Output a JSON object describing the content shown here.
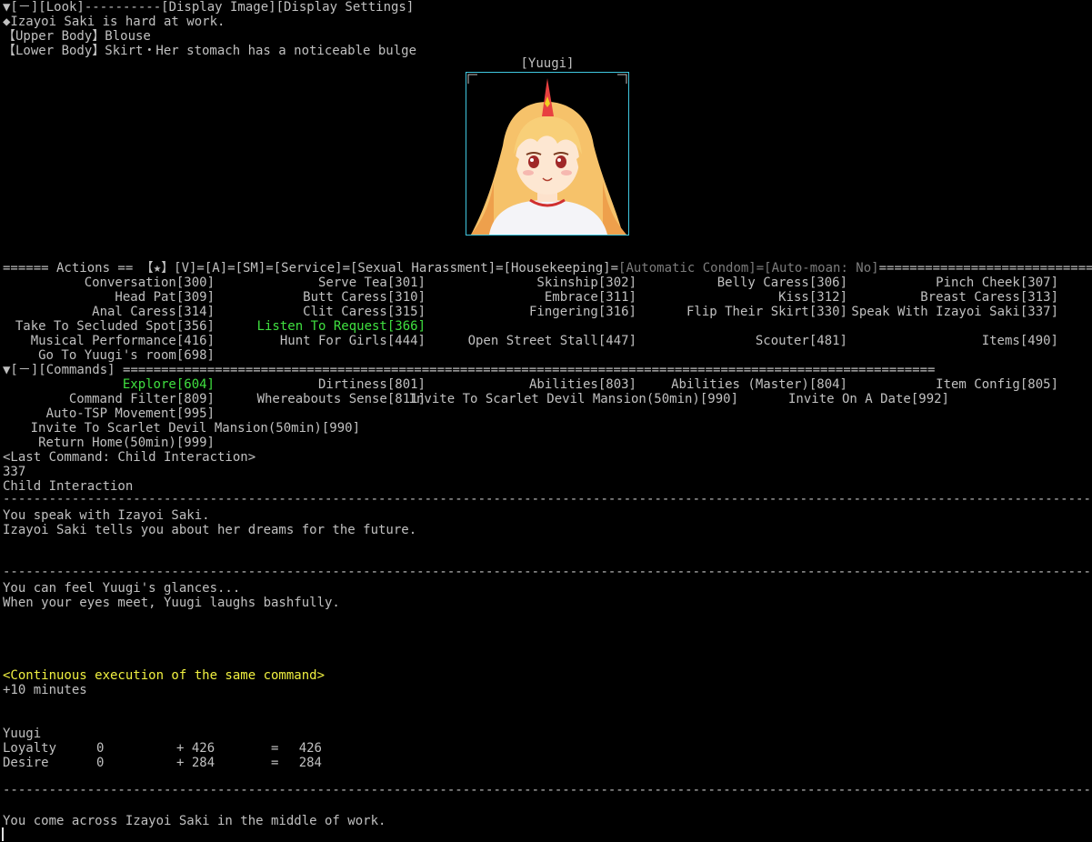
{
  "header": {
    "menu_line": "▼[－][Look]----------[Display Image][Display Settings]",
    "status_line": "◆Izayoi Saki is hard at work.",
    "upper_body": "【Upper Body】Blouse",
    "lower_body": "【Lower Body】Skirt・Her stomach has a noticeable bulge"
  },
  "portrait": {
    "label": "[Yuugi]",
    "frame_color": "#40c8e0"
  },
  "actions": {
    "divider_prefix": "====== Actions == 【★】[V]=[A]=[SM]=[Service]=[Sexual Harassment]=[Housekeeping]=",
    "divider_gray": "[Automatic Condom]=[Auto-moan: No]",
    "divider_suffix": "==================================",
    "rows": [
      [
        "Conversation[300]",
        "Serve Tea[301]",
        "Skinship[302]",
        "Belly Caress[306]",
        "Pinch Cheek[307]"
      ],
      [
        "Head Pat[309]",
        "Butt Caress[310]",
        "Embrace[311]",
        "Kiss[312]",
        "Breast Caress[313]"
      ],
      [
        "Anal Caress[314]",
        "Clit Caress[315]",
        "Fingering[316]",
        "Flip Their Skirt[330]",
        "Speak With Izayoi Saki[337]"
      ],
      [
        "Take To Secluded Spot[356]",
        "Listen To Request[366]",
        "",
        "",
        ""
      ],
      [
        "Musical Performance[416]",
        "Hunt For Girls[444]",
        "Open Street Stall[447]",
        "Scouter[481]",
        "Items[490]"
      ],
      [
        "Go To Yuugi's room[698]",
        "",
        "",
        "",
        ""
      ]
    ]
  },
  "commands": {
    "divider_label": "▼[－][Commands]",
    "divider_fill": "==========================================================================================================",
    "rows": [
      [
        "Explore[604]",
        "Dirtiness[801]",
        "Abilities[803]",
        "Abilities (Master)[804]",
        "Item Config[805]"
      ],
      [
        "Command Filter[809]",
        "Whereabouts Sense[811]",
        "Invite To Scarlet Devil Mansion(50min)[990]",
        "",
        "Invite On A Date[992]"
      ]
    ],
    "extra": [
      "Auto-TSP Movement[995]",
      "Invite To Scarlet Devil Mansion(50min)[990]",
      "Return Home(50min)[999]"
    ]
  },
  "log": {
    "last_command": "<Last Command: Child Interaction>",
    "command_number": "337",
    "command_name": "Child Interaction",
    "separator": "--------------------------------------------------------------------------------------------------------------------------------------------------------------",
    "block1": [
      "You speak with Izayoi Saki.",
      "Izayoi Saki tells you about her dreams for the future."
    ],
    "block2": [
      "You can feel Yuugi's glances...",
      "When your eyes meet, Yuugi laughs bashfully."
    ],
    "continuous": "<Continuous execution of the same command>",
    "time_added": "+10 minutes",
    "stats_name": "Yuugi",
    "stats": [
      {
        "label": "Loyalty",
        "base": "0",
        "delta": "+ 426",
        "eq": "=",
        "total": "426"
      },
      {
        "label": "Desire",
        "base": "0",
        "delta": "+ 284",
        "eq": "=",
        "total": "284"
      }
    ],
    "final_line": "You come across Izayoi Saki in the middle of work."
  },
  "colors": {
    "background": "#000000",
    "text": "#c0c0c0",
    "highlight_green": "#40e040",
    "disabled_gray": "#7c7c7c",
    "notice_yellow": "#f0f040"
  }
}
